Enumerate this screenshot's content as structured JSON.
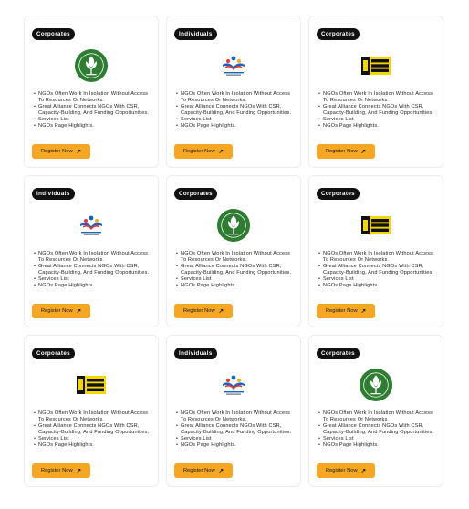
{
  "colors": {
    "accent": "#f5a623",
    "badge_bg": "#111111",
    "logo_green": "#2e7d32",
    "logo_yellow": "#f2d600"
  },
  "cards": [
    {
      "badge": "Corporates",
      "logo": "green-circle-logo",
      "features": [
        "NGOs Often Work In Isolation Without Access To Resources Or Networks.",
        "Great Alliance Connects NGOs With CSR, Capacity-Building, And Funding Opportunities.",
        "Services List",
        "NGOs Page Highlights."
      ],
      "button": "Register Now",
      "button_icon": "arrow-up-right-icon"
    },
    {
      "badge": "Individuals",
      "logo": "sardar-bharat-logo",
      "logo_text": "SARDAR BHARAT FOUNDATION",
      "features": [
        "NGOs Often Work In Isolation Without Access To Resources Or Networks.",
        "Great Alliance Connects NGOs With CSR, Capacity-Building, And Funding Opportunities.",
        "Services List",
        "NGOs Page Highlights."
      ],
      "button": "Register Now",
      "button_icon": "arrow-up-right-icon"
    },
    {
      "badge": "Corporates",
      "logo": "need-base-india-logo",
      "logo_text": "NEED BASE INDIA",
      "features": [
        "NGOs Often Work In Isolation Without Access To Resources Or Networks.",
        "Great Alliance Connects NGOs With CSR, Capacity-Building, And Funding Opportunities.",
        "Services List",
        "NGOs Page Highlights."
      ],
      "button": "Register Now",
      "button_icon": "arrow-up-right-icon"
    },
    {
      "badge": "Individuals",
      "logo": "sardar-bharat-logo",
      "logo_text": "SARDAR BHARAT FOUNDATION",
      "features": [
        "NGOs Often Work In Isolation Without Access To Resources Or Networks.",
        "Great Alliance Connects NGOs With CSR, Capacity-Building, And Funding Opportunities.",
        "Services List",
        "NGOs Page Highlights."
      ],
      "button": "Register Now",
      "button_icon": "arrow-up-right-icon"
    },
    {
      "badge": "Corporates",
      "logo": "green-circle-logo",
      "features": [
        "NGOs Often Work In Isolation Without Access To Resources Or Networks.",
        "Great Alliance Connects NGOs With CSR, Capacity-Building, And Funding Opportunities.",
        "Services List",
        "NGOs Page Highlights."
      ],
      "button": "Register Now",
      "button_icon": "arrow-up-right-icon"
    },
    {
      "badge": "Corporates",
      "logo": "need-base-india-logo",
      "logo_text": "NEED BASE INDIA",
      "features": [
        "NGOs Often Work In Isolation Without Access To Resources Or Networks.",
        "Great Alliance Connects NGOs With CSR, Capacity-Building, And Funding Opportunities.",
        "Services List",
        "NGOs Page Highlights."
      ],
      "button": "Register Now",
      "button_icon": "arrow-up-right-icon"
    },
    {
      "badge": "Corporates",
      "logo": "need-base-india-logo",
      "logo_text": "NEED BASE INDIA",
      "features": [
        "NGOs Often Work In Isolation Without Access To Resources Or Networks.",
        "Great Alliance Connects NGOs With CSR, Capacity-Building, And Funding Opportunities.",
        "Services List",
        "NGOs Page Highlights."
      ],
      "button": "Register Now",
      "button_icon": "arrow-up-right-icon"
    },
    {
      "badge": "Individuals",
      "logo": "sardar-bharat-logo",
      "logo_text": "SARDAR BHARAT FOUNDATION",
      "features": [
        "NGOs Often Work In Isolation Without Access To Resources Or Networks.",
        "Great Alliance Connects NGOs With CSR, Capacity-Building, And Funding Opportunities.",
        "Services List",
        "NGOs Page Highlights."
      ],
      "button": "Register Now",
      "button_icon": "arrow-up-right-icon"
    },
    {
      "badge": "Corporates",
      "logo": "green-circle-logo",
      "features": [
        "NGOs Often Work In Isolation Without Access To Resources Or Networks.",
        "Great Alliance Connects NGOs With CSR, Capacity-Building, And Funding Opportunities.",
        "Services List",
        "NGOs Page Highlights."
      ],
      "button": "Register Now",
      "button_icon": "arrow-up-right-icon"
    }
  ]
}
